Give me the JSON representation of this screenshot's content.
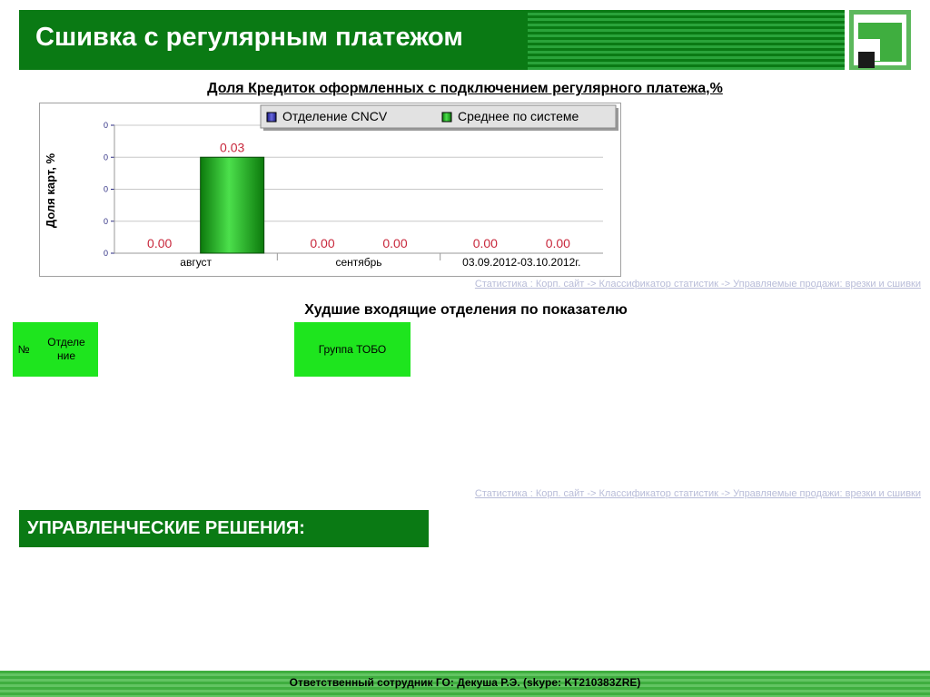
{
  "header": {
    "title": "Сшивка с регулярным платежом",
    "accent_color": "#0a7a14"
  },
  "logo": {
    "icon": "bank-logo-icon"
  },
  "chart_data": {
    "type": "bar",
    "title": "Доля Кредиток оформленных с подключением регулярного платежа,%",
    "ylabel": "Доля карт, %",
    "xlabel": "",
    "categories": [
      "август",
      "сентябрь",
      "03.09.2012-03.10.2012г."
    ],
    "series": [
      {
        "name": "Отделение CNCV",
        "color": "#2a2aa0",
        "values": [
          0.0,
          0.0,
          0.0
        ]
      },
      {
        "name": "Среднее по системе",
        "color": "#18a818",
        "values": [
          0.03,
          0.0,
          0.0
        ]
      }
    ],
    "data_labels": [
      [
        "0.00",
        "0.03"
      ],
      [
        "0.00",
        "0.00"
      ],
      [
        "0.00",
        "0.00"
      ]
    ],
    "y_tick_labels": [
      "0",
      "0",
      "0",
      "0",
      "0"
    ],
    "ylim": [
      0,
      0.04
    ],
    "grid": true,
    "legend_position": "top-right",
    "label_color": "#c8283c"
  },
  "source_links": [
    "Статистика : Корп. сайт -> Классификатор статистик -> Управляемые продажи: врезки и сшивки",
    "Статистика : Корп. сайт -> Классификатор статистик -> Управляемые продажи: врезки и сшивки"
  ],
  "worst_table": {
    "title": "Худшие входящие отделения по показателю",
    "columns": [
      "№",
      "Отделение",
      "Группа ТОБО"
    ]
  },
  "decisions": {
    "title": "УПРАВЛЕНЧЕСКИЕ РЕШЕНИЯ:"
  },
  "footer": {
    "text": "Ответственный сотрудник ГО: Декуша Р.Э. (skype: KT210383ZRE)"
  }
}
